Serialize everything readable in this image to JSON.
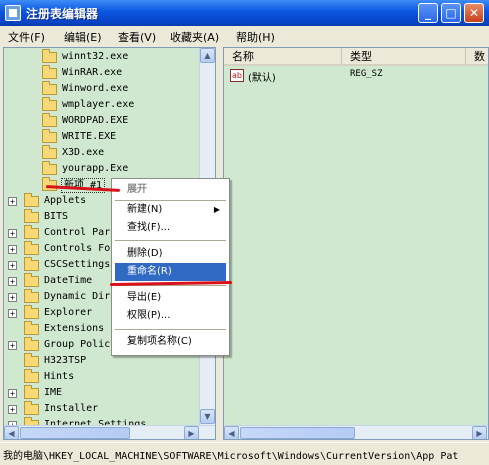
{
  "window": {
    "title": "注册表编辑器"
  },
  "menubar": [
    "文件(F)",
    "编辑(E)",
    "查看(V)",
    "收藏夹(A)",
    "帮助(H)"
  ],
  "tree": {
    "app_paths_items": [
      "winnt32.exe",
      "WinRAR.exe",
      "Winword.exe",
      "wmplayer.exe",
      "WORDPAD.EXE",
      "WRITE.EXE",
      "X3D.exe",
      "yourapp.Exe"
    ],
    "new_key": "新项 #1",
    "top_items": [
      "Applets",
      "BITS",
      "Control Par",
      "Controls Fo",
      "CSCSettings",
      "DateTime",
      "Dynamic Dir",
      "Explorer",
      "Extensions",
      "Group Polic",
      "H323TSP",
      "Hints",
      "IME",
      "Installer",
      "Internet Settings"
    ]
  },
  "list": {
    "headers": [
      "名称",
      "类型",
      "数"
    ],
    "rows": [
      {
        "name": "(默认)",
        "type": "REG_SZ",
        "icon": "ab"
      }
    ]
  },
  "context_menu": {
    "items": [
      "展开",
      "新建(N)",
      "查找(F)...",
      "删除(D)",
      "重命名(R)",
      "导出(E)",
      "权限(P)...",
      "复制项名称(C)"
    ],
    "selected": "重命名(R)"
  },
  "status": {
    "path": "我的电脑\\HKEY_LOCAL_MACHINE\\SOFTWARE\\Microsoft\\Windows\\CurrentVersion\\App Pat"
  },
  "colors": {
    "title_blue": "#0a55e0",
    "pane_bg": "#cfe8cf",
    "highlight": "#316ac5",
    "annotation_red": "#d8121a"
  }
}
